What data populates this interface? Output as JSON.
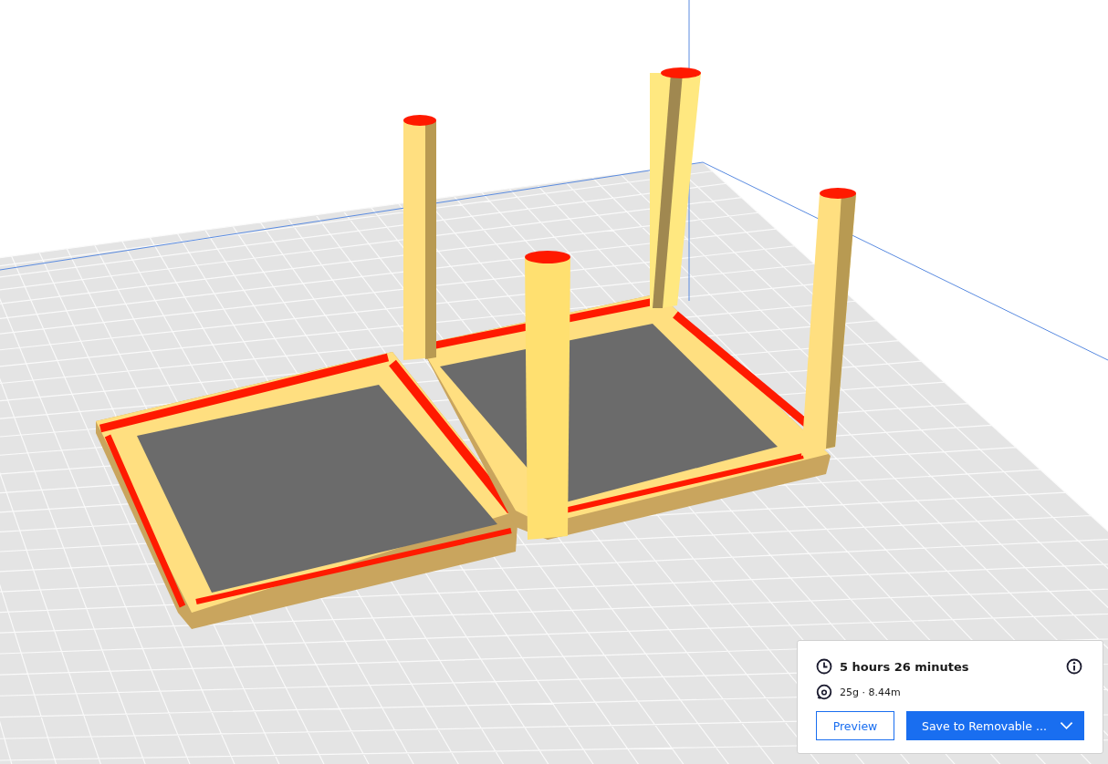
{
  "print_info": {
    "time": "5 hours 26 minutes",
    "material": "25g · 8.44m"
  },
  "buttons": {
    "preview": "Preview",
    "save": "Save to Removable ..."
  }
}
